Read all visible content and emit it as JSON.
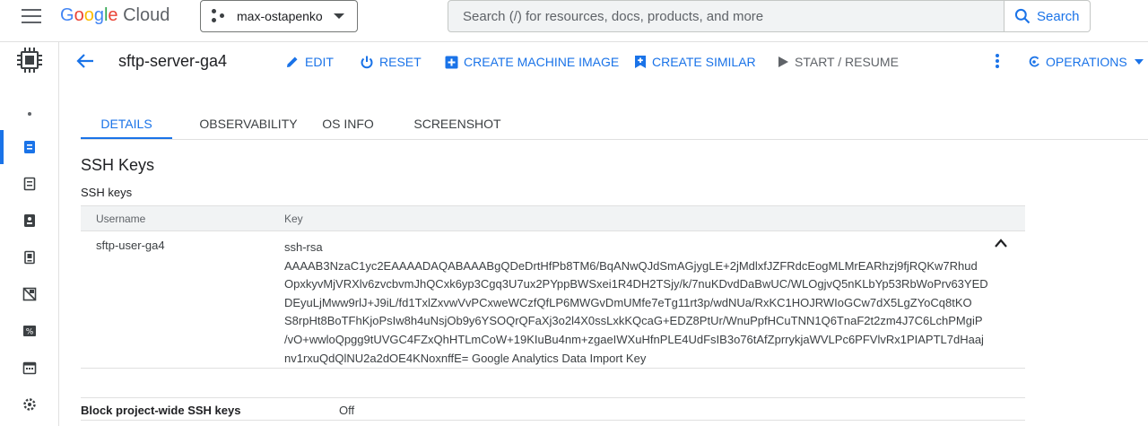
{
  "header": {
    "logo": {
      "G": "G",
      "o1": "o",
      "o2": "o",
      "g": "g",
      "l": "l",
      "e": "e",
      "cloud": "Cloud"
    },
    "project_name": "max-ostapenko",
    "search_placeholder": "Search (/) for resources, docs, products, and more",
    "search_button": "Search"
  },
  "instance": {
    "title": "sftp-server-ga4",
    "actions": {
      "edit": "EDIT",
      "reset": "RESET",
      "create_machine_image": "CREATE MACHINE IMAGE",
      "create_similar": "CREATE SIMILAR",
      "start_resume": "START / RESUME",
      "operations": "OPERATIONS"
    }
  },
  "tabs": [
    {
      "label": "DETAILS",
      "active": true
    },
    {
      "label": "OBSERVABILITY",
      "active": false
    },
    {
      "label": "OS INFO",
      "active": false
    },
    {
      "label": "SCREENSHOT",
      "active": false
    }
  ],
  "ssh": {
    "section_title": "SSH Keys",
    "subsection_title": "SSH keys",
    "columns": {
      "username": "Username",
      "key": "Key"
    },
    "rows": [
      {
        "username": "sftp-user-ga4",
        "key_lines": [
          "ssh-rsa",
          "AAAAB3NzaC1yc2EAAAADAQABAAABgQDeDrtHfPb8TM6/BqANwQJdSmAGjygLE+2jMdlxfJZFRdcEogMLMrEARhzj9fjRQKw7Rhud",
          "OpxkyvMjVRXlv6zvcbvmJhQCxk6yp3Cgq3U7ux2PYppBWSxei1R4DH2TSjy/k/7nuKDvdDaBwUC/WLOgjvQ5nKLbYp53RbWoPrv63YED",
          "DEyuLjMww9rlJ+J9iL/fd1TxlZxvwVvPCxweWCzfQfLP6MWGvDmUMfe7eTg11rt3p/wdNUa/RxKC1HOJRWIoGCw7dX5LgZYoCq8tKO",
          "S8rpHt8BoTFhKjoPsIw8h4uNsjOb9y6YSOQrQFaXj3o2l4X0ssLxkKQcaG+EDZ8PtUr/WnuPpfHCuTNN1Q6TnaF2t2zm4J7C6LchPMgiP",
          "/vO+wwloQpgg9tUVGC4FZxQhHTLmCoW+19KIuBu4nm+zgaeIWXuHfnPLE4UdFsIB3o76tAfZprrykjaWVLPc6PFVlvRx1PIAPTL7dHaaj",
          "nv1rxuQdQlNU2a2dOE4KNoxnffE= Google Analytics Data Import Key"
        ]
      }
    ]
  },
  "block_project_ssh": {
    "label": "Block project-wide SSH keys",
    "value": "Off"
  },
  "colors": {
    "accent": "#1a73e8",
    "text": "#202124",
    "muted": "#5f6368"
  }
}
